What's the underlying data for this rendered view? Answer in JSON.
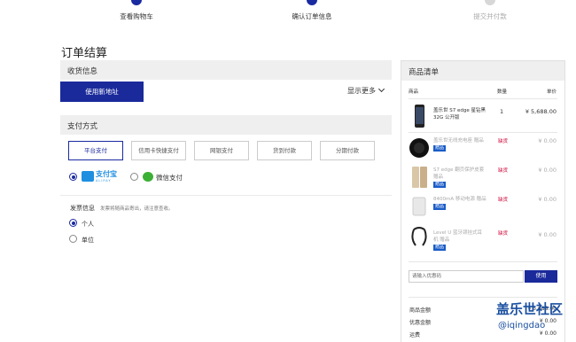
{
  "steps": [
    {
      "label": "查看购物车",
      "state": "done"
    },
    {
      "label": "确认订单信息",
      "state": "current"
    },
    {
      "label": "提交并付款",
      "state": "pending"
    }
  ],
  "page_title": "订单结算",
  "shipping": {
    "heading": "收货信息",
    "add_address_label": "使用新地址",
    "show_more_label": "显示更多"
  },
  "payment": {
    "heading": "支付方式",
    "options": [
      "平台支付",
      "信用卡快捷支付",
      "网银支付",
      "货到付款",
      "分期付款"
    ],
    "selected": "平台支付",
    "methods": [
      {
        "name": "alipay",
        "label": "支付宝",
        "sub": "ALIPAY",
        "selected": true
      },
      {
        "name": "wechat",
        "label": "微信支付",
        "selected": false
      }
    ]
  },
  "invoice": {
    "label": "发票信息",
    "note": "发票将随商品寄出，请注意查收。",
    "options": [
      {
        "label": "个人",
        "selected": true
      },
      {
        "label": "单位",
        "selected": false
      }
    ]
  },
  "cart": {
    "heading": "商品清单",
    "columns": {
      "product": "商品",
      "qty": "数量",
      "price": "单价"
    },
    "items": [
      {
        "name": "盖乐世 S7 edge 星钻黑 32G 公开版",
        "qty": "1",
        "price": "¥ 5,688.00",
        "gift": false,
        "out_of_stock": ""
      },
      {
        "name": "盖乐世无线充电座 赠品",
        "qty": "",
        "price": "¥ 0.00",
        "gift": true,
        "out_of_stock": "缺货"
      },
      {
        "name": "S7 edge 翻页保护皮套 赠品",
        "qty": "",
        "price": "¥ 0.00",
        "gift": true,
        "out_of_stock": "缺货"
      },
      {
        "name": "8400mA 移动电源 赠品",
        "qty": "",
        "price": "¥ 0.00",
        "gift": true,
        "out_of_stock": "缺货"
      },
      {
        "name": "Level U 蓝牙颈挂式耳机 赠品",
        "qty": "",
        "price": "¥ 0.00",
        "gift": true,
        "out_of_stock": "缺货"
      }
    ],
    "gift_tag": "赠品",
    "coupon_placeholder": "请输入优惠码",
    "coupon_button": "使用",
    "summary": [
      {
        "label": "商品金额",
        "value": "¥ 5,688.00"
      },
      {
        "label": "优惠金额",
        "value": "¥ 0.00"
      },
      {
        "label": "运费",
        "value": "¥ 0.00"
      }
    ]
  },
  "watermark": {
    "title": "盖乐世社区",
    "sub": "@iqingdao"
  },
  "colors": {
    "accent": "#1a2aa0",
    "out_of_stock": "#cc0033",
    "alipay": "#1f8fe0",
    "wechat": "#3cb034"
  }
}
